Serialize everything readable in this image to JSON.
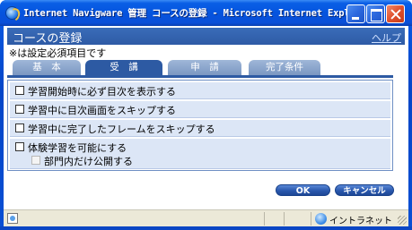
{
  "window": {
    "title": "Internet Navigware 管理 コースの登録 - Microsoft Internet Explorer"
  },
  "page": {
    "title": "コースの登録",
    "help_label": "ヘルプ",
    "note": "※は設定必須項目です"
  },
  "tabs": [
    {
      "label": "基　本",
      "active": false
    },
    {
      "label": "受　講",
      "active": true
    },
    {
      "label": "申　請",
      "active": false
    },
    {
      "label": "完了条件",
      "active": false
    }
  ],
  "options": [
    {
      "label": "学習開始時に必ず目次を表示する",
      "checked": false
    },
    {
      "label": "学習中に目次画面をスキップする",
      "checked": false
    },
    {
      "label": "学習中に完了したフレームをスキップする",
      "checked": false
    },
    {
      "label": "体験学習を可能にする",
      "checked": false,
      "sub": {
        "label": "部門内だけ公開する",
        "checked": false,
        "disabled": true
      }
    }
  ],
  "buttons": {
    "ok": "OK",
    "cancel": "キャンセル"
  },
  "statusbar": {
    "zone": "イントラネット"
  },
  "colors": {
    "header": "#2f5ea8",
    "tab_active": "#2d5aa3",
    "tab_inactive": "#8ea7cf",
    "row_bg": "#dce6f6"
  }
}
